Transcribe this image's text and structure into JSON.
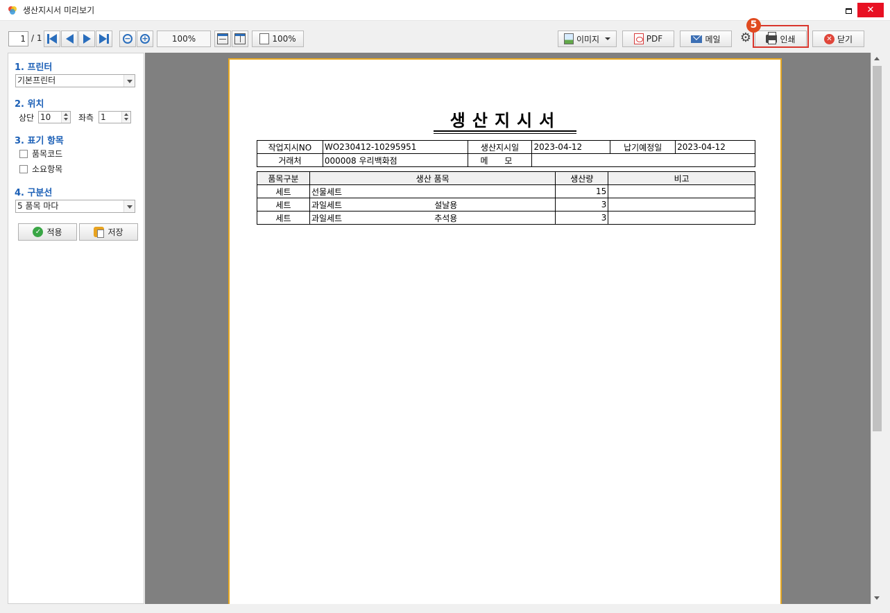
{
  "window": {
    "title": "생산지시서 미리보기",
    "close_glyph": "✕"
  },
  "toolbar": {
    "page_current": "1",
    "page_total": "/ 1",
    "zoom_level": "100%",
    "zoom_preview": "100%",
    "image_label": "이미지",
    "pdf_label": "PDF",
    "mail_label": "메일",
    "print_label": "인쇄",
    "close_label": "닫기",
    "step_badge": "5"
  },
  "panel": {
    "printer": {
      "title": "1. 프린터",
      "value": "기본프린터"
    },
    "position": {
      "title": "2. 위치",
      "top_label": "상단",
      "top_value": "10",
      "left_label": "좌측",
      "left_value": "1"
    },
    "display": {
      "title": "3. 표기 항목",
      "item_code": "품목코드",
      "required_item": "소요항목"
    },
    "separator": {
      "title": "4. 구분선",
      "value": "5 품목 마다"
    },
    "apply_label": "적용",
    "save_label": "저장"
  },
  "document": {
    "title": "생산지시서",
    "header": {
      "order_no_label": "작업지시NO",
      "order_no": "WO230412-10295951",
      "prod_date_label": "생산지시일",
      "prod_date": "2023-04-12",
      "due_date_label": "납기예정일",
      "due_date": "2023-04-12",
      "client_label": "거래처",
      "client": "000008 우리백화점",
      "memo_label": "메 모",
      "memo": ""
    },
    "items_header": {
      "category": "품목구분",
      "product": "생산 품목",
      "qty": "생산량",
      "note": "비고"
    },
    "items": [
      {
        "category": "세트",
        "product": "선물세트",
        "spec": "",
        "qty": "15",
        "note": ""
      },
      {
        "category": "세트",
        "product": "과일세트",
        "spec": "설날용",
        "qty": "3",
        "note": ""
      },
      {
        "category": "세트",
        "product": "과일세트",
        "spec": "추석용",
        "qty": "3",
        "note": ""
      }
    ]
  }
}
